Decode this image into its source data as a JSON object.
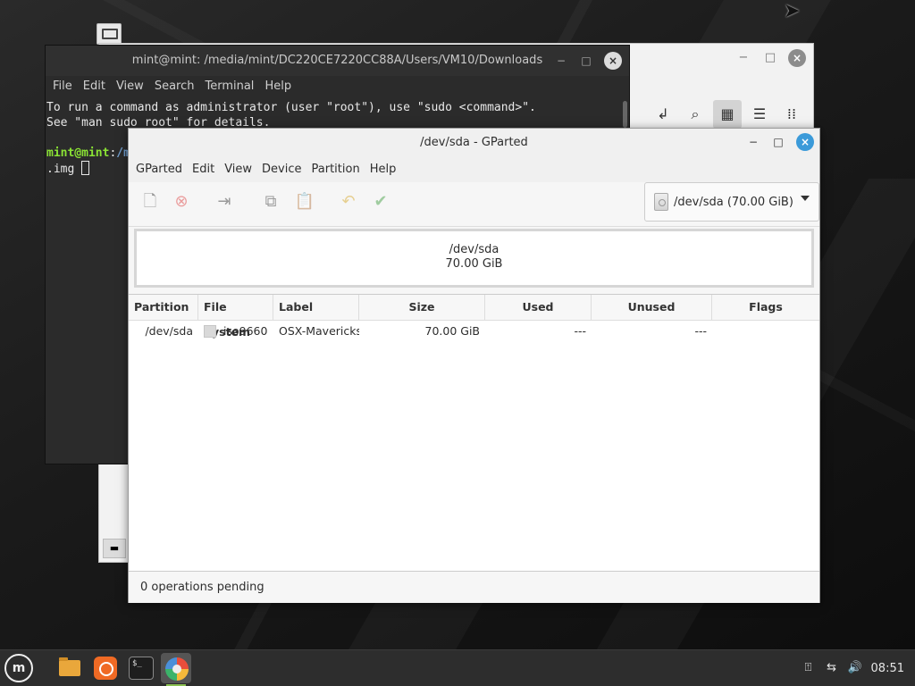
{
  "terminal": {
    "title": "mint@mint: /media/mint/DC220CE7220CC88A/Users/VM10/Downloads",
    "menu": [
      "File",
      "Edit",
      "View",
      "Search",
      "Terminal",
      "Help"
    ],
    "line1": "To run a command as administrator (user \"root\"), use \"sudo <command>\".",
    "line2": "See \"man sudo_root\" for details.",
    "prompt_user": "mint@mint",
    "prompt_sep": ":",
    "prompt_path": "/m",
    "line_img": ".img"
  },
  "nemo": {
    "min": "−",
    "max": "□",
    "close": "×"
  },
  "gparted": {
    "title": "/dev/sda - GParted",
    "menu": [
      "GParted",
      "Edit",
      "View",
      "Device",
      "Partition",
      "Help"
    ],
    "device_selector": "/dev/sda  (70.00 GiB)",
    "disk_map": {
      "device": "/dev/sda",
      "size": "70.00 GiB"
    },
    "columns": [
      "Partition",
      "File System",
      "Label",
      "Size",
      "Used",
      "Unused",
      "Flags"
    ],
    "rows": [
      {
        "partition": "/dev/sda",
        "filesystem": "iso9660",
        "label": "OSX-Mavericks",
        "size": "70.00 GiB",
        "used": "---",
        "unused": "---",
        "flags": ""
      }
    ],
    "status": "0 operations pending"
  },
  "taskbar": {
    "clock": "08:51"
  }
}
